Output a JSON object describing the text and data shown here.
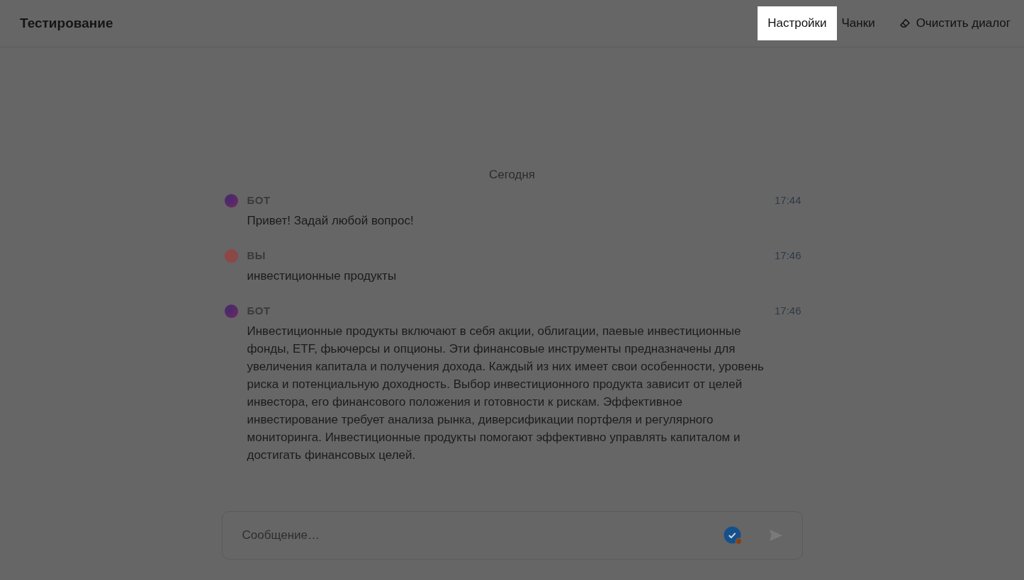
{
  "header": {
    "title": "Тестирование",
    "nav": [
      {
        "label": "Настройки",
        "selected": true,
        "kind": "text"
      },
      {
        "label": "Чанки",
        "selected": false,
        "kind": "text"
      },
      {
        "label": "Очистить диалог",
        "selected": false,
        "kind": "eraser"
      }
    ]
  },
  "chat": {
    "date": "Сегодня",
    "messages": [
      {
        "kind": "bot",
        "author": "БОТ",
        "time": "17:44",
        "color": "#4a2b6b",
        "text": "Привет! Задай любой вопрос!"
      },
      {
        "kind": "user",
        "author": "ВЫ",
        "time": "17:46",
        "color": "#8c4747",
        "text": "инвестиционные продукты"
      },
      {
        "kind": "bot",
        "author": "БОТ",
        "time": "17:46",
        "color": "#4a2b6b",
        "text": "Инвестиционные продукты включают в себя акции, облигации, паевые инвестиционные фонды, ETF, фьючерсы и опционы. Эти финансовые инструменты предназначены для увеличения капитала и получения дохода. Каждый из них имеет свои особенности, уровень риска и потенциальную доходность. Выбор инвестиционного продукта зависит от целей инвестора, его финансового положения и готовности к рискам. Эффективное инвестирование требует анализа рынка, диверсификации портфеля и регулярного мониторинга. Инвестиционные продукты помогают эффективно управлять капиталом и достигать финансовых целей."
      }
    ]
  },
  "composer": {
    "placeholder": "Сообщение…"
  }
}
